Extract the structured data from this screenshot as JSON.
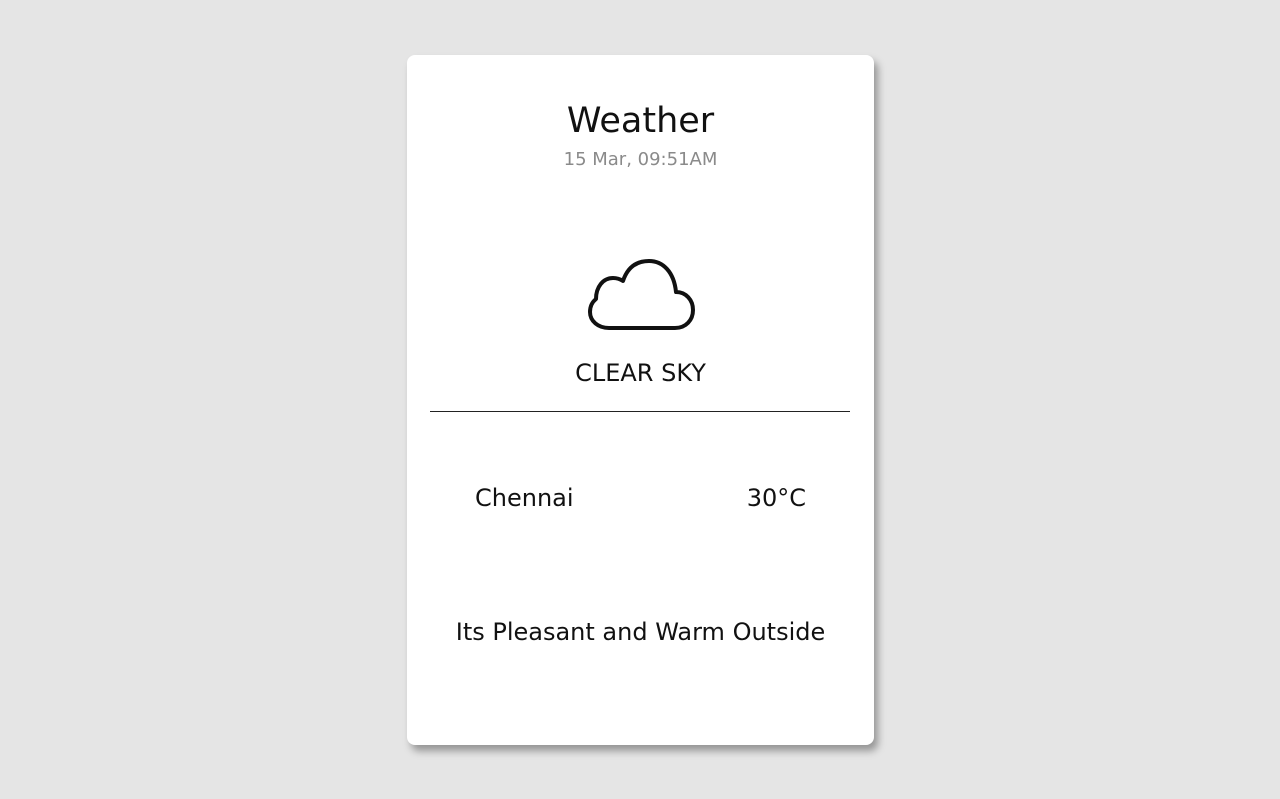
{
  "header": {
    "title": "Weather",
    "datetime": "15 Mar, 09:51AM"
  },
  "condition": {
    "icon": "cloud-icon",
    "label": "CLEAR SKY"
  },
  "details": {
    "city": "Chennai",
    "temperature": "30°C"
  },
  "message": "Its Pleasant and Warm Outside",
  "colors": {
    "background": "#e5e5e5",
    "card": "#ffffff",
    "text": "#111111",
    "muted": "#8a8a8a"
  }
}
